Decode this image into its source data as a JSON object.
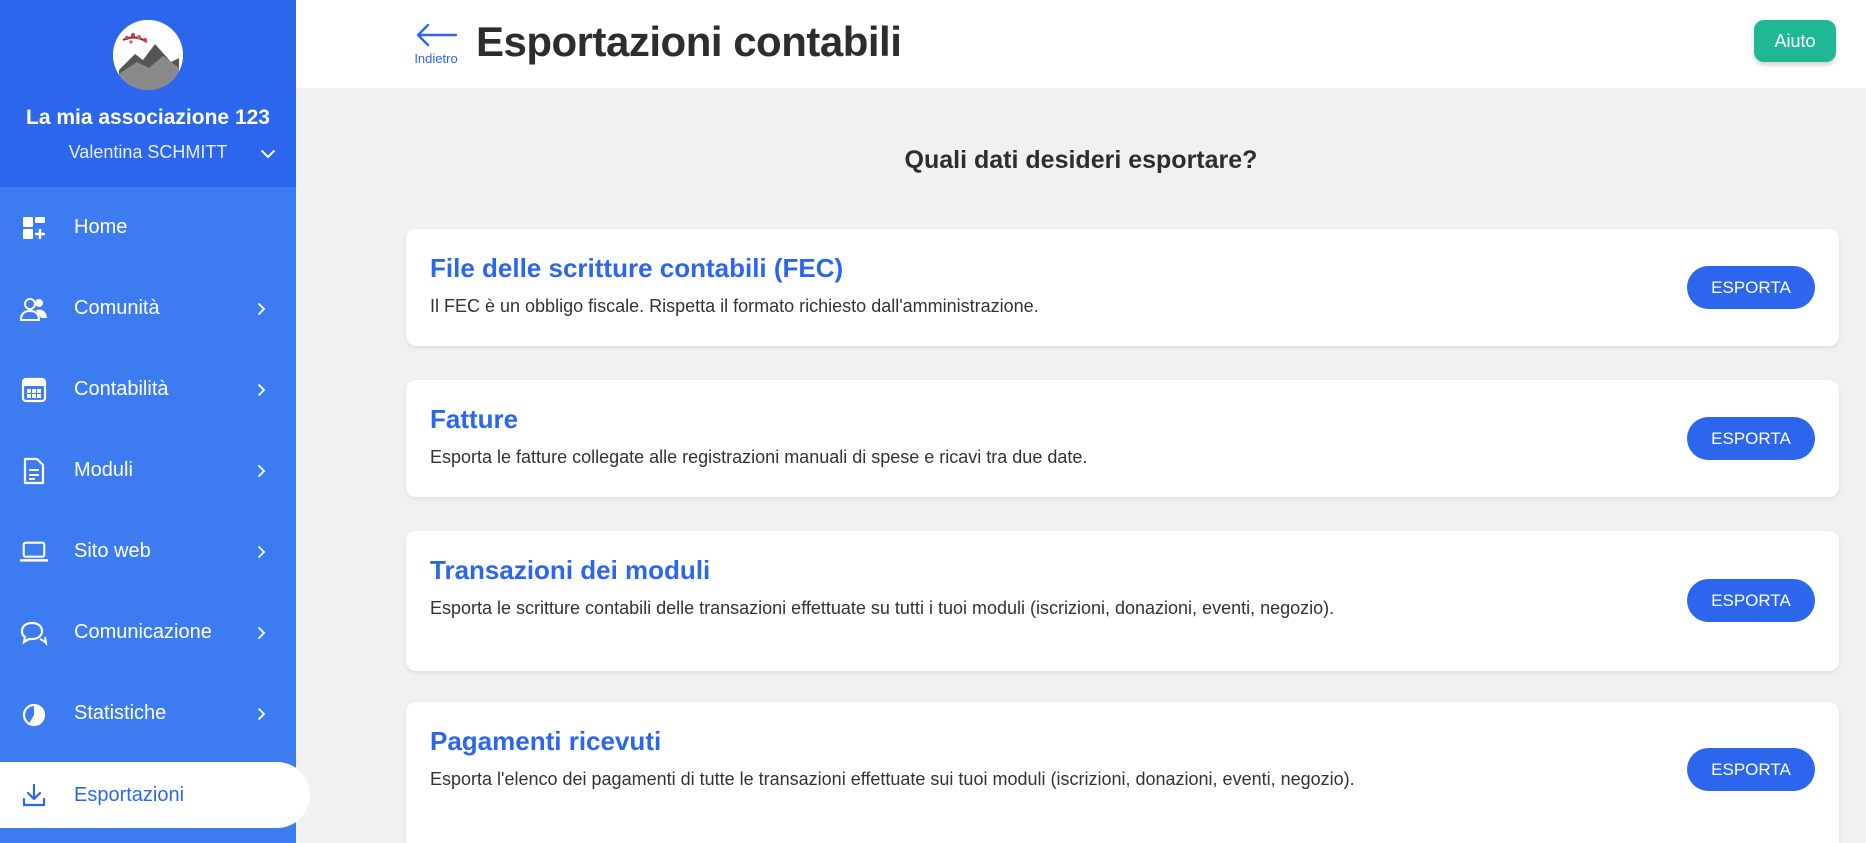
{
  "sidebar": {
    "association_name": "La mia associazione 123",
    "user_name": "Valentina SCHMITT",
    "items": [
      {
        "label": "Home",
        "icon": "dashboard-icon"
      },
      {
        "label": "Comunità",
        "icon": "users-icon"
      },
      {
        "label": "Contabilità",
        "icon": "calculator-icon"
      },
      {
        "label": "Moduli",
        "icon": "document-icon"
      },
      {
        "label": "Sito web",
        "icon": "laptop-icon"
      },
      {
        "label": "Comunicazione",
        "icon": "chat-icon"
      },
      {
        "label": "Statistiche",
        "icon": "pie-chart-icon"
      },
      {
        "label": "Esportazioni",
        "icon": "download-icon",
        "active": true
      }
    ]
  },
  "header": {
    "back_label": "Indietro",
    "title": "Esportazioni contabili",
    "help_label": "Aiuto"
  },
  "main": {
    "question": "Quali dati desideri esportare?",
    "cards": [
      {
        "title": "File delle scritture contabili (FEC)",
        "description": "Il FEC è un obbligo fiscale. Rispetta il formato richiesto dall'amministrazione.",
        "button": "ESPORTA"
      },
      {
        "title": "Fatture",
        "description": "Esporta le fatture collegate alle registrazioni manuali di spese e ricavi tra due date.",
        "button": "ESPORTA"
      },
      {
        "title": "Transazioni dei moduli",
        "description": "Esporta le scritture contabili delle transazioni effettuate su tutti i tuoi moduli (iscrizioni, donazioni, eventi, negozio).",
        "button": "ESPORTA"
      },
      {
        "title": "Pagamenti ricevuti",
        "description": "Esporta l'elenco dei pagamenti di tutte le transazioni effettuate sui tuoi moduli (iscrizioni, donazioni, eventi, negozio).",
        "button": "ESPORTA"
      }
    ]
  },
  "colors": {
    "sidebar_bg": "#3d7cf0",
    "sidebar_header_bg": "#2b66ec",
    "accent": "#2b66ec",
    "help_button": "#1fb794"
  }
}
